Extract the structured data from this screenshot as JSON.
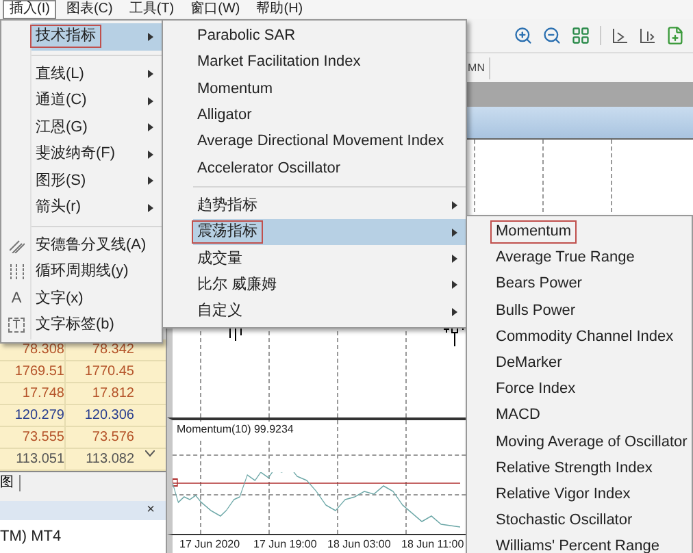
{
  "menu_bar": [
    {
      "label": "插入(I)",
      "selected": true
    },
    {
      "label": "图表(C)",
      "selected": false
    },
    {
      "label": "工具(T)",
      "selected": false
    },
    {
      "label": "窗口(W)",
      "selected": false
    },
    {
      "label": "帮助(H)",
      "selected": false
    }
  ],
  "insert_menu": [
    {
      "kind": "item",
      "label": "技术指标",
      "submenu": true,
      "selected": true,
      "marked": true
    },
    {
      "kind": "separator"
    },
    {
      "kind": "item",
      "label": "直线(L)",
      "submenu": true,
      "selected": false,
      "marked": false
    },
    {
      "kind": "item",
      "label": "通道(C)",
      "submenu": true,
      "selected": false,
      "marked": false
    },
    {
      "kind": "item",
      "label": "江恩(G)",
      "submenu": true,
      "selected": false,
      "marked": false
    },
    {
      "kind": "item",
      "label": "斐波纳奇(F)",
      "submenu": true,
      "selected": false,
      "marked": false
    },
    {
      "kind": "item",
      "label": "图形(S)",
      "submenu": true,
      "selected": false,
      "marked": false
    },
    {
      "kind": "item",
      "label": "箭头(r)",
      "submenu": true,
      "selected": false,
      "marked": false
    },
    {
      "kind": "separator"
    },
    {
      "kind": "pitchfork",
      "label": "安德鲁分叉线(A)",
      "submenu": false,
      "selected": false,
      "marked": false
    },
    {
      "kind": "cycles",
      "label": "循环周期线(y)",
      "submenu": false,
      "selected": false,
      "marked": false
    },
    {
      "kind": "item",
      "label": "文字(x)",
      "submenu": false,
      "selected": false,
      "marked": false,
      "glyph": "A"
    },
    {
      "kind": "item",
      "label": "文字标签(b)",
      "submenu": false,
      "selected": false,
      "marked": false,
      "boxed_glyph": "T"
    }
  ],
  "indicators_menu": [
    {
      "kind": "item",
      "label": "Parabolic SAR",
      "submenu": false,
      "selected": false,
      "marked": false
    },
    {
      "kind": "item",
      "label": "Market Facilitation Index",
      "submenu": false,
      "selected": false,
      "marked": false
    },
    {
      "kind": "item",
      "label": "Momentum",
      "submenu": false,
      "selected": false,
      "marked": false
    },
    {
      "kind": "item",
      "label": "Alligator",
      "submenu": false,
      "selected": false,
      "marked": false
    },
    {
      "kind": "item",
      "label": "Average Directional Movement Index",
      "submenu": false,
      "selected": false,
      "marked": false
    },
    {
      "kind": "item",
      "label": "Accelerator Oscillator",
      "submenu": false,
      "selected": false,
      "marked": false
    },
    {
      "kind": "separator"
    },
    {
      "kind": "item",
      "label": "趋势指标",
      "submenu": true,
      "selected": false,
      "marked": false
    },
    {
      "kind": "item",
      "label": "震荡指标",
      "submenu": true,
      "selected": true,
      "marked": true
    },
    {
      "kind": "item",
      "label": "成交量",
      "submenu": true,
      "selected": false,
      "marked": false
    },
    {
      "kind": "item",
      "label": "比尔 威廉姆",
      "submenu": true,
      "selected": false,
      "marked": false
    },
    {
      "kind": "item",
      "label": "自定义",
      "submenu": true,
      "selected": false,
      "marked": false
    }
  ],
  "oscillators_menu": [
    {
      "kind": "item",
      "label": "Momentum",
      "submenu": false,
      "selected": false,
      "marked": true
    },
    {
      "kind": "item",
      "label": "Average True Range",
      "submenu": false,
      "selected": false,
      "marked": false
    },
    {
      "kind": "item",
      "label": "Bears Power",
      "submenu": false,
      "selected": false,
      "marked": false
    },
    {
      "kind": "item",
      "label": "Bulls Power",
      "submenu": false,
      "selected": false,
      "marked": false
    },
    {
      "kind": "item",
      "label": "Commodity Channel Index",
      "submenu": false,
      "selected": false,
      "marked": false
    },
    {
      "kind": "item",
      "label": "DeMarker",
      "submenu": false,
      "selected": false,
      "marked": false
    },
    {
      "kind": "item",
      "label": "Force Index",
      "submenu": false,
      "selected": false,
      "marked": false
    },
    {
      "kind": "item",
      "label": "MACD",
      "submenu": false,
      "selected": false,
      "marked": false
    },
    {
      "kind": "item",
      "label": "Moving Average of Oscillator",
      "submenu": false,
      "selected": false,
      "marked": false
    },
    {
      "kind": "item",
      "label": "Relative Strength Index",
      "submenu": false,
      "selected": false,
      "marked": false
    },
    {
      "kind": "item",
      "label": "Relative Vigor Index",
      "submenu": false,
      "selected": false,
      "marked": false
    },
    {
      "kind": "item",
      "label": "Stochastic Oscillator",
      "submenu": false,
      "selected": false,
      "marked": false
    },
    {
      "kind": "item",
      "label": "Williams' Percent Range",
      "submenu": false,
      "selected": false,
      "marked": false
    }
  ],
  "quotes": [
    {
      "bid": "78.308",
      "ask": "78.342",
      "color": "#b5542a"
    },
    {
      "bid": "1769.51",
      "ask": "1770.45",
      "color": "#b5542a"
    },
    {
      "bid": "17.748",
      "ask": "17.812",
      "color": "#b5542a"
    },
    {
      "bid": "120.279",
      "ask": "120.306",
      "color": "#2a3f8f"
    },
    {
      "bid": "73.555",
      "ask": "73.576",
      "color": "#b5542a"
    },
    {
      "bid": "113.051",
      "ask": "113.082",
      "color": "#555555"
    }
  ],
  "bottom_tab": "图",
  "navigator": {
    "close": "×",
    "item": "TM) MT4"
  },
  "chart": {
    "period_tab": "MN",
    "indicator_label": "Momentum(10) 99.9234",
    "time_labels": [
      "17 Jun 2020",
      "17 Jun 19:00",
      "18 Jun 03:00",
      "18 Jun 11:00"
    ]
  }
}
